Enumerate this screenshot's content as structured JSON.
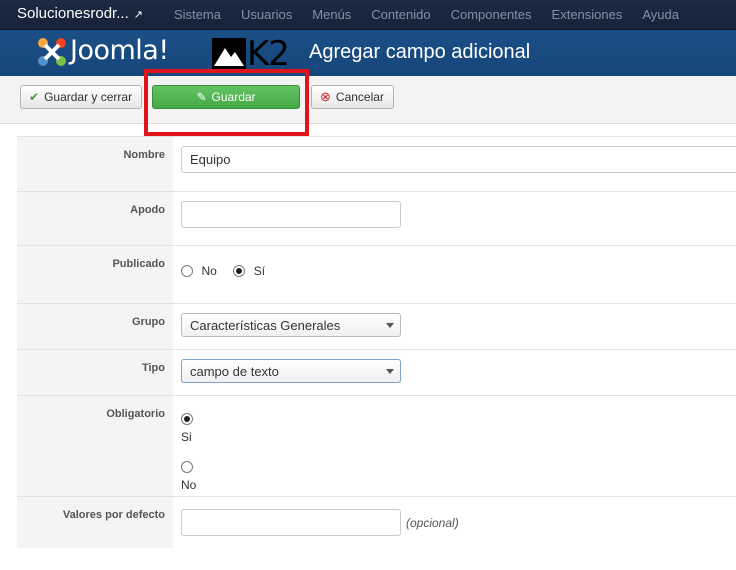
{
  "navbar": {
    "site_name": "Solucionesrodr...",
    "menu": [
      "Sistema",
      "Usuarios",
      "Menús",
      "Contenido",
      "Componentes",
      "Extensiones",
      "Ayuda"
    ]
  },
  "header": {
    "joomla_logo_text": "Joomla!",
    "k2_logo_text": "K2",
    "title": "Agregar campo adicional"
  },
  "toolbar": {
    "save_close_label": "Guardar y cerrar",
    "save_label": "Guardar",
    "cancel_label": "Cancelar"
  },
  "form": {
    "nombre": {
      "label": "Nombre",
      "value": "Equipo"
    },
    "apodo": {
      "label": "Apodo",
      "value": ""
    },
    "publicado": {
      "label": "Publicado",
      "options": [
        "No",
        "Sí"
      ],
      "selected": "Sí"
    },
    "grupo": {
      "label": "Grupo",
      "value": "Características Generales"
    },
    "tipo": {
      "label": "Tipo",
      "value": "campo de texto"
    },
    "obligatorio": {
      "label": "Obligatorio",
      "options": [
        "Si",
        "No"
      ],
      "selected": "Si"
    },
    "valores": {
      "label": "Valores por defecto",
      "value": "",
      "hint": "(opcional)"
    }
  },
  "colors": {
    "navbar_bg": "#1c2a44",
    "header_bg": "#1a4f86",
    "save_button": "#4cae4c",
    "highlight_box": "#e0141b"
  }
}
